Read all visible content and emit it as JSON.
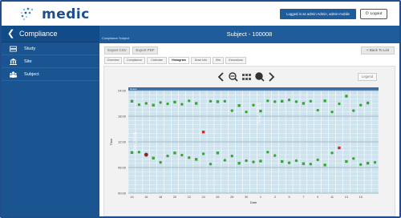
{
  "header": {
    "logo_text": "medic",
    "logged_in": "Logged in as admin   Admin, admin-mobile",
    "logout_label": "Logout"
  },
  "sidebar": {
    "title": "Compliance",
    "items": [
      {
        "label": "Study",
        "icon": "study-icon"
      },
      {
        "label": "Site",
        "icon": "site-icon"
      },
      {
        "label": "Subject",
        "icon": "subject-icon"
      }
    ]
  },
  "main": {
    "breadcrumb": "Compliance Subject",
    "title": "Subject - 100008",
    "export_csv": "Export CSV",
    "export_pdf": "Export PDF",
    "back_label": "< Back To List",
    "tabs": [
      "Overview",
      "Compliance",
      "Calendar",
      "Histogram",
      "Dose Info",
      "Kits",
      "Excursions"
    ],
    "active_tab": "Histogram",
    "legend_label": "Legend"
  },
  "chart_data": {
    "type": "scatter",
    "xlabel": "Date",
    "ylabel": "Time",
    "x_ticks": [
      "14",
      "16",
      "18",
      "20",
      "22",
      "24",
      "26",
      "28",
      "30",
      "1",
      "3",
      "5",
      "7",
      "9",
      "11",
      "13",
      "15"
    ],
    "y_ticks": [
      "00:00",
      "06:00",
      "12:00",
      "18:00",
      "24:00"
    ],
    "ylim": [
      0,
      24
    ],
    "top_band_label": "Doses",
    "vertical_labels": [
      "Oct 2015",
      "Nov 2015"
    ],
    "colors": {
      "on_time": "#3aa53a",
      "late": "#d9262b",
      "missed": "#8b2a1f"
    },
    "series": [
      {
        "name": "evening",
        "points": [
          {
            "x": 0,
            "y": 21.5,
            "status": "on_time"
          },
          {
            "x": 1,
            "y": 20.7,
            "status": "on_time"
          },
          {
            "x": 2,
            "y": 21.0,
            "status": "on_time"
          },
          {
            "x": 3,
            "y": 20.6,
            "status": "on_time"
          },
          {
            "x": 4,
            "y": 21.2,
            "status": "on_time"
          },
          {
            "x": 5,
            "y": 20.9,
            "status": "on_time"
          },
          {
            "x": 6,
            "y": 21.3,
            "status": "on_time"
          },
          {
            "x": 7,
            "y": 20.8,
            "status": "on_time"
          },
          {
            "x": 8,
            "y": 21.6,
            "status": "on_time"
          },
          {
            "x": 9,
            "y": 21.0,
            "status": "on_time"
          },
          {
            "x": 10,
            "y": 14.3,
            "status": "late"
          },
          {
            "x": 11,
            "y": 21.5,
            "status": "on_time"
          },
          {
            "x": 12,
            "y": 21.4,
            "status": "on_time"
          },
          {
            "x": 13,
            "y": 21.5,
            "status": "on_time"
          },
          {
            "x": 14,
            "y": 19.3,
            "status": "on_time"
          },
          {
            "x": 15,
            "y": 20.5,
            "status": "on_time"
          },
          {
            "x": 16,
            "y": 19.0,
            "status": "on_time"
          },
          {
            "x": 17,
            "y": 20.6,
            "status": "on_time"
          },
          {
            "x": 18,
            "y": 19.2,
            "status": "on_time"
          },
          {
            "x": 19,
            "y": 21.6,
            "status": "on_time"
          },
          {
            "x": 20,
            "y": 21.4,
            "status": "on_time"
          },
          {
            "x": 21,
            "y": 21.5,
            "status": "on_time"
          },
          {
            "x": 22,
            "y": 21.8,
            "status": "on_time"
          },
          {
            "x": 23,
            "y": 21.4,
            "status": "on_time"
          },
          {
            "x": 24,
            "y": 21.0,
            "status": "on_time"
          },
          {
            "x": 25,
            "y": 21.5,
            "status": "on_time"
          },
          {
            "x": 26,
            "y": 19.4,
            "status": "on_time"
          },
          {
            "x": 27,
            "y": 21.6,
            "status": "on_time"
          },
          {
            "x": 28,
            "y": 19.0,
            "status": "on_time"
          },
          {
            "x": 29,
            "y": 20.9,
            "status": "on_time"
          },
          {
            "x": 30,
            "y": 22.7,
            "status": "on_time"
          },
          {
            "x": 31,
            "y": 19.3,
            "status": "on_time"
          },
          {
            "x": 32,
            "y": 20.6,
            "status": "on_time"
          },
          {
            "x": 33,
            "y": 21.1,
            "status": "on_time"
          }
        ]
      },
      {
        "name": "morning",
        "points": [
          {
            "x": 0,
            "y": 9.5,
            "status": "on_time"
          },
          {
            "x": 1,
            "y": 9.6,
            "status": "on_time"
          },
          {
            "x": 2,
            "y": 9.0,
            "status": "missed"
          },
          {
            "x": 3,
            "y": 8.2,
            "status": "on_time"
          },
          {
            "x": 4,
            "y": 7.2,
            "status": "on_time"
          },
          {
            "x": 5,
            "y": 8.7,
            "status": "on_time"
          },
          {
            "x": 6,
            "y": 9.4,
            "status": "on_time"
          },
          {
            "x": 7,
            "y": 8.9,
            "status": "on_time"
          },
          {
            "x": 8,
            "y": 8.3,
            "status": "on_time"
          },
          {
            "x": 9,
            "y": 7.9,
            "status": "on_time"
          },
          {
            "x": 10,
            "y": 9.2,
            "status": "on_time"
          },
          {
            "x": 11,
            "y": 6.8,
            "status": "on_time"
          },
          {
            "x": 12,
            "y": 9.4,
            "status": "on_time"
          },
          {
            "x": 13,
            "y": 7.7,
            "status": "on_time"
          },
          {
            "x": 14,
            "y": 8.7,
            "status": "on_time"
          },
          {
            "x": 15,
            "y": 7.0,
            "status": "on_time"
          },
          {
            "x": 16,
            "y": 7.6,
            "status": "on_time"
          },
          {
            "x": 17,
            "y": 7.3,
            "status": "on_time"
          },
          {
            "x": 18,
            "y": 7.5,
            "status": "on_time"
          },
          {
            "x": 19,
            "y": 9.6,
            "status": "on_time"
          },
          {
            "x": 20,
            "y": 8.8,
            "status": "on_time"
          },
          {
            "x": 21,
            "y": 7.4,
            "status": "on_time"
          },
          {
            "x": 22,
            "y": 7.1,
            "status": "on_time"
          },
          {
            "x": 23,
            "y": 7.6,
            "status": "on_time"
          },
          {
            "x": 24,
            "y": 6.9,
            "status": "on_time"
          },
          {
            "x": 25,
            "y": 6.8,
            "status": "on_time"
          },
          {
            "x": 26,
            "y": 7.8,
            "status": "on_time"
          },
          {
            "x": 27,
            "y": 6.6,
            "status": "on_time"
          },
          {
            "x": 28,
            "y": 9.4,
            "status": "on_time"
          },
          {
            "x": 29,
            "y": 10.6,
            "status": "late"
          },
          {
            "x": 30,
            "y": 7.4,
            "status": "on_time"
          },
          {
            "x": 31,
            "y": 8.1,
            "status": "on_time"
          },
          {
            "x": 32,
            "y": 6.7,
            "status": "on_time"
          },
          {
            "x": 33,
            "y": 7.0,
            "status": "on_time"
          },
          {
            "x": 34,
            "y": 7.2,
            "status": "on_time"
          }
        ]
      }
    ]
  }
}
